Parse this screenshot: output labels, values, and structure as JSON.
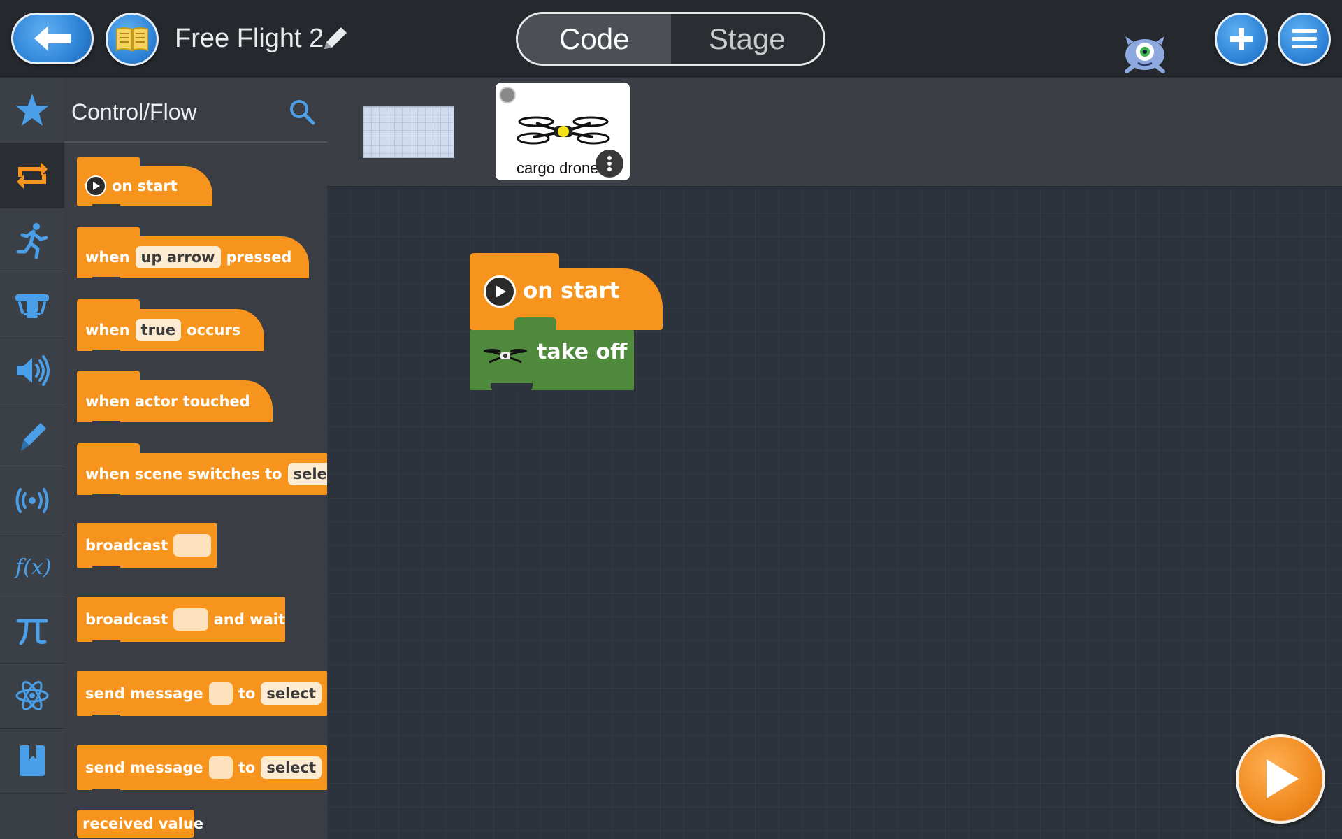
{
  "header": {
    "project_title": "Free Flight 2",
    "tabs": [
      {
        "label": "Code",
        "active": true
      },
      {
        "label": "Stage",
        "active": false
      }
    ]
  },
  "sidebar": {
    "categories": [
      {
        "icon": "star-icon"
      },
      {
        "icon": "loop-arrows-icon",
        "active": true
      },
      {
        "icon": "running-person-icon"
      },
      {
        "icon": "drone-part-icon"
      },
      {
        "icon": "speaker-icon"
      },
      {
        "icon": "pen-icon"
      },
      {
        "icon": "broadcast-icon"
      },
      {
        "icon": "function-icon"
      },
      {
        "icon": "pi-icon"
      },
      {
        "icon": "atom-icon"
      },
      {
        "icon": "bookmark-icon"
      }
    ]
  },
  "palette": {
    "title": "Control/Flow",
    "blocks": {
      "on_start": "on start",
      "when_key": {
        "prefix": "when",
        "key": "up arrow",
        "suffix": "pressed"
      },
      "when_occurs": {
        "prefix": "when",
        "value": "true",
        "suffix": "occurs"
      },
      "actor_touched": "when actor touched",
      "scene_switch": {
        "prefix": "when scene switches to",
        "value": "select"
      },
      "broadcast": "broadcast",
      "broadcast_wait": {
        "prefix": "broadcast",
        "suffix": "and wait"
      },
      "send_message_1": {
        "prefix": "send message",
        "middle": "to",
        "value": "select"
      },
      "send_message_2": {
        "prefix": "send message",
        "middle": "to",
        "value": "select"
      },
      "received_value": "received value"
    }
  },
  "actors": {
    "selected": {
      "name": "cargo drone"
    }
  },
  "script": {
    "hat_label": "on start",
    "action_label": "take off"
  },
  "colors": {
    "control_block": "#f7941d",
    "drone_block": "#4f8a3c",
    "canvas_bg": "#2d333c",
    "primary_button": "#2d82d6",
    "run_button": "#f08a1e"
  }
}
